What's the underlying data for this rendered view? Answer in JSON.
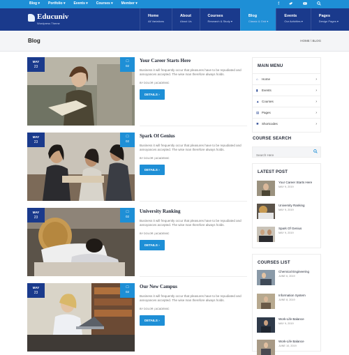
{
  "topbar": {
    "nav": [
      "Blog ▾",
      "Portfolio ▾",
      "Events ▾",
      "Courses ▾",
      "Member ▾"
    ],
    "social_icons": [
      "facebook-icon",
      "twitter-icon",
      "youtube-icon",
      "search-icon"
    ]
  },
  "brand": {
    "name": "Educuniv",
    "tagline": "Wordpress Theme"
  },
  "mainnav": [
    {
      "title": "Home",
      "sub": "All Variations"
    },
    {
      "title": "About",
      "sub": "About Us"
    },
    {
      "title": "Courses",
      "sub": "Research & Study ▾"
    },
    {
      "title": "Blog",
      "sub": "Classic & Grid ▾"
    },
    {
      "title": "Events",
      "sub": "Our Activities ▾"
    },
    {
      "title": "Pages",
      "sub": "Design Pages ▾"
    }
  ],
  "page": {
    "title": "Blog",
    "breadcrumb": "HOME \\ BLOG"
  },
  "posts": [
    {
      "month": "MAY",
      "day": "23",
      "comments": "02",
      "title": "Your Career Starts Here",
      "excerpt": "Business it will frequently occur that pleasures have to be repudiated and annoyances accepted. The wise man therefore always holds.",
      "meta": "BY DOLOR  |  ACADEMIC",
      "button": "DETAILS"
    },
    {
      "month": "MAY",
      "day": "23",
      "comments": "02",
      "title": "Spark Of Genius",
      "excerpt": "Business it will frequently occur that pleasures have to be repudiated and annoyances accepted. The wise man therefore always holds.",
      "meta": "BY DOLOR  |  ACADEMIC",
      "button": "DETAILS"
    },
    {
      "month": "MAY",
      "day": "23",
      "comments": "02",
      "title": "University Ranking",
      "excerpt": "Business it will frequently occur that pleasures have to be repudiated and annoyances accepted. The wise man therefore always holds.",
      "meta": "BY DOLOR  |  ACADEMIC",
      "button": "DETAILS"
    },
    {
      "month": "MAY",
      "day": "23",
      "comments": "02",
      "title": "Our New Campus",
      "excerpt": "Business it will frequently occur that pleasures have to be repudiated and annoyances accepted. The wise man therefore always holds.",
      "meta": "BY DOLOR  |  ACADEMIC",
      "button": "DETAILS"
    }
  ],
  "sidebar": {
    "menu_title": "MAIN MENU",
    "menu": [
      {
        "label": "Home",
        "icon": "home-icon"
      },
      {
        "label": "Events",
        "icon": "bookmark-icon"
      },
      {
        "label": "Courses",
        "icon": "graduation-cap-icon"
      },
      {
        "label": "Pages",
        "icon": "file-icon"
      },
      {
        "label": "Shortcodes",
        "icon": "gear-icon"
      }
    ],
    "search_title": "COURSE SEARCH",
    "search_placeholder": "Search Here",
    "latest_title": "LATEST POST",
    "latest": [
      {
        "title": "Your Career Starts Here",
        "date": "MAY 9, 2019"
      },
      {
        "title": "University Ranking",
        "date": "MAY 9, 2019"
      },
      {
        "title": "Spark Of Genius",
        "date": "MAY 9, 2019"
      }
    ],
    "courses_title": "COURSES LIST",
    "courses": [
      {
        "title": "Chemical Engineering",
        "date": "JUNE 6, 2019"
      },
      {
        "title": "Information System",
        "date": "JUNE 8, 2019"
      },
      {
        "title": "Work-Life Balance",
        "date": "MAY 9, 2019"
      },
      {
        "title": "Work-Life Balance",
        "date": "JUNE 10, 2019"
      }
    ]
  },
  "colors": {
    "topbar": "#1e8fd6",
    "header": "#1a3a8c",
    "accent": "#1e8fd6"
  }
}
